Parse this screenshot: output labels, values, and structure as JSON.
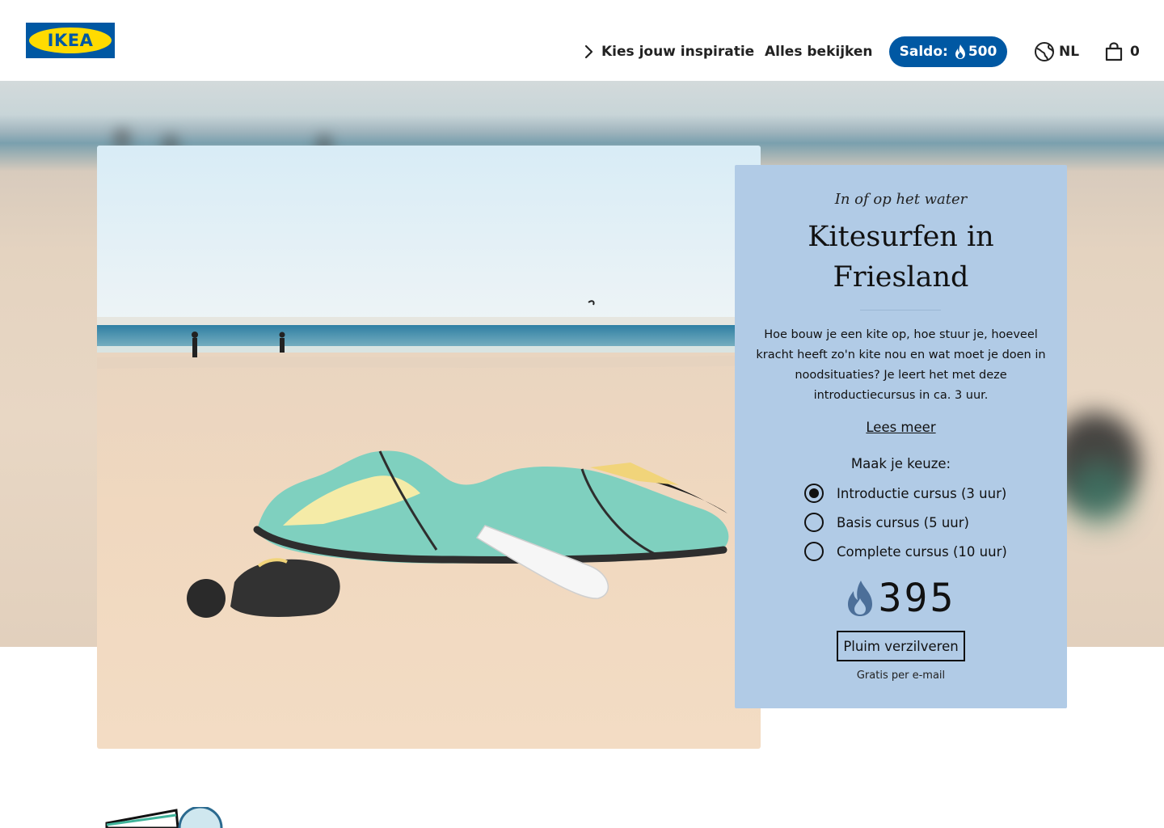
{
  "header": {
    "logo_text": "IKEA",
    "nav_inspiration": "Kies jouw inspiratie",
    "nav_all": "Alles bekijken",
    "saldo_label": "Saldo:",
    "saldo_value": "500",
    "language": "NL",
    "cart_count": "0"
  },
  "card": {
    "subtitle": "In of op het water",
    "title": "Kitesurfen in Friesland",
    "description": "Hoe bouw je een kite op, hoe stuur je, hoeveel kracht heeft zo'n kite nou en wat moet je doen in noodsituaties? Je leert het met deze introductiecursus in ca. 3 uur.",
    "read_more": "Lees meer",
    "choice_prompt": "Maak je keuze:",
    "options": [
      {
        "label": "Introductie cursus (3 uur)",
        "selected": true
      },
      {
        "label": "Basis cursus (5 uur)",
        "selected": false
      },
      {
        "label": "Complete cursus (10 uur)",
        "selected": false
      }
    ],
    "price": "395",
    "redeem_button": "Pluim verzilveren",
    "note": "Gratis per e-mail"
  },
  "colors": {
    "brand_blue": "#0058a3",
    "brand_yellow": "#ffdb00",
    "card_bg": "#b1cbe6"
  },
  "icons": [
    "chevron-right-icon",
    "flame-icon",
    "globe-icon",
    "shopping-bag-icon"
  ]
}
